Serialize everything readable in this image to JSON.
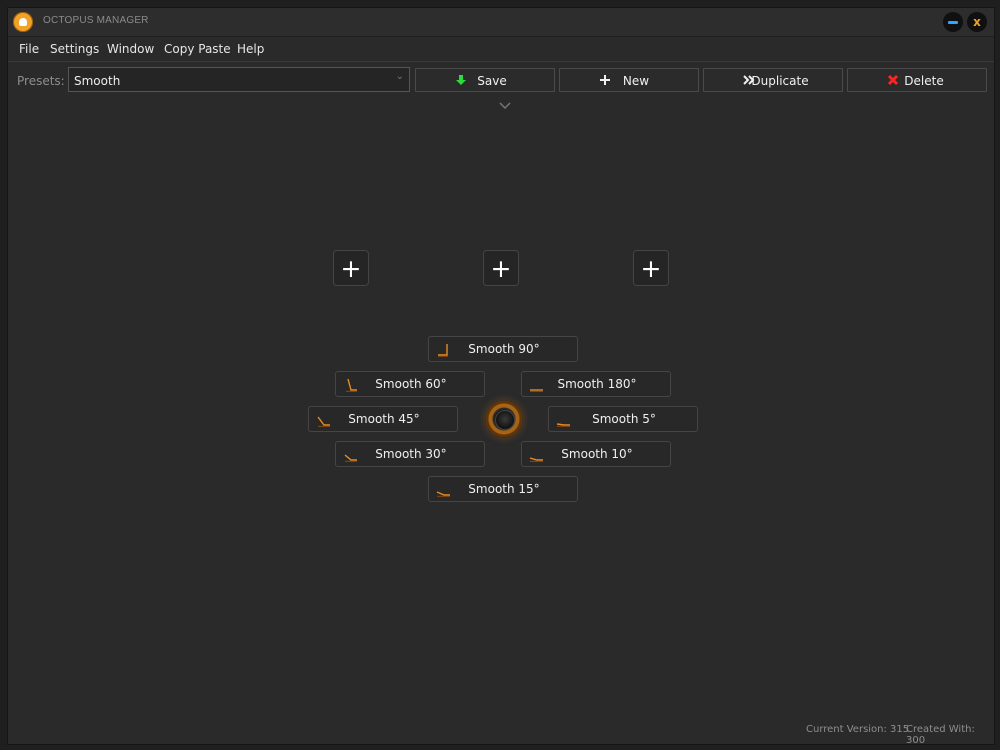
{
  "window": {
    "title": "OCTOPUS MANAGER"
  },
  "menu": {
    "items": [
      "File",
      "Settings",
      "Window",
      "Copy Paste",
      "Help"
    ]
  },
  "toolbar": {
    "presets_label": "Presets:",
    "preset_value": "Smooth",
    "buttons": {
      "save": "Save",
      "new": "New",
      "duplicate": "Duplicate",
      "delete": "Delete"
    }
  },
  "smooth_options": [
    {
      "label": "Smooth 90°"
    },
    {
      "label": "Smooth 60°"
    },
    {
      "label": "Smooth 180°"
    },
    {
      "label": "Smooth 45°"
    },
    {
      "label": "Smooth 5°"
    },
    {
      "label": "Smooth 30°"
    },
    {
      "label": "Smooth 10°"
    },
    {
      "label": "Smooth 15°"
    }
  ],
  "footer": {
    "current_version": "Current Version: 315",
    "created_with": "Created With: 300"
  },
  "colors": {
    "accent_orange": "#f0a326",
    "minimize_blue": "#28a8ff",
    "save_green": "#2ddc3a",
    "delete_red": "#ff2424"
  },
  "icons": {
    "save": "arrow-down-icon",
    "new": "plus-icon",
    "duplicate": "double-chevron-icon",
    "delete": "x-icon",
    "window_close": "close-icon",
    "window_minimize": "minimize-icon"
  }
}
